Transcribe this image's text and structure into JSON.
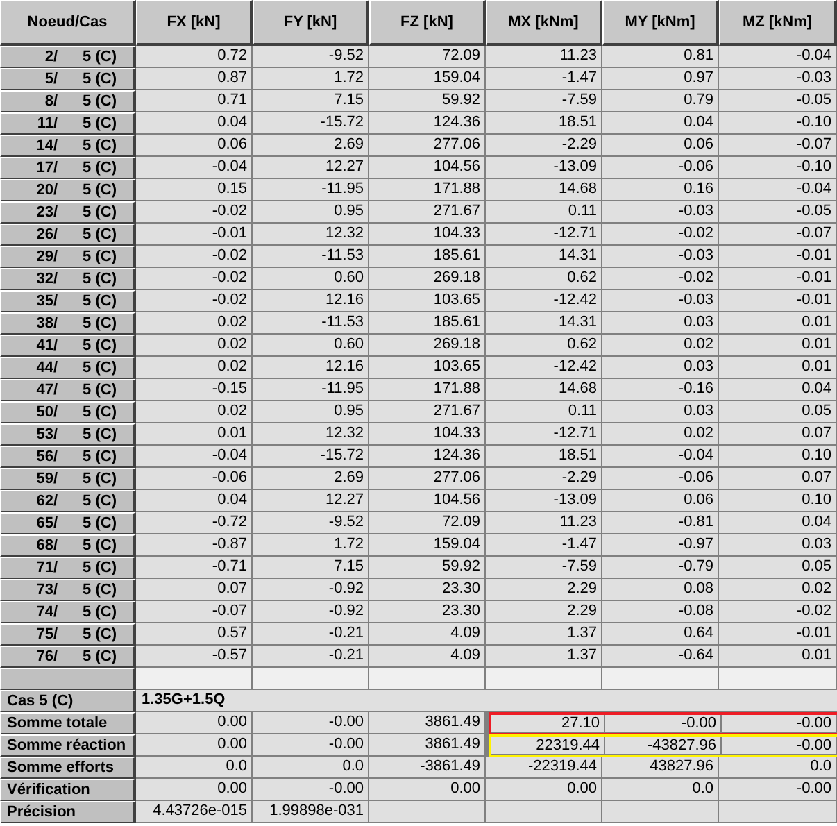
{
  "table": {
    "columns": [
      "Noeud/Cas",
      "FX [kN]",
      "FY [kN]",
      "FZ [kN]",
      "MX [kNm]",
      "MY [kNm]",
      "MZ [kNm]"
    ],
    "rows": [
      {
        "node": "2/",
        "case": "5 (C)",
        "values": [
          "0.72",
          "-9.52",
          "72.09",
          "11.23",
          "0.81",
          "-0.04"
        ]
      },
      {
        "node": "5/",
        "case": "5 (C)",
        "values": [
          "0.87",
          "1.72",
          "159.04",
          "-1.47",
          "0.97",
          "-0.03"
        ]
      },
      {
        "node": "8/",
        "case": "5 (C)",
        "values": [
          "0.71",
          "7.15",
          "59.92",
          "-7.59",
          "0.79",
          "-0.05"
        ]
      },
      {
        "node": "11/",
        "case": "5 (C)",
        "values": [
          "0.04",
          "-15.72",
          "124.36",
          "18.51",
          "0.04",
          "-0.10"
        ]
      },
      {
        "node": "14/",
        "case": "5 (C)",
        "values": [
          "0.06",
          "2.69",
          "277.06",
          "-2.29",
          "0.06",
          "-0.07"
        ]
      },
      {
        "node": "17/",
        "case": "5 (C)",
        "values": [
          "-0.04",
          "12.27",
          "104.56",
          "-13.09",
          "-0.06",
          "-0.10"
        ]
      },
      {
        "node": "20/",
        "case": "5 (C)",
        "values": [
          "0.15",
          "-11.95",
          "171.88",
          "14.68",
          "0.16",
          "-0.04"
        ]
      },
      {
        "node": "23/",
        "case": "5 (C)",
        "values": [
          "-0.02",
          "0.95",
          "271.67",
          "0.11",
          "-0.03",
          "-0.05"
        ]
      },
      {
        "node": "26/",
        "case": "5 (C)",
        "values": [
          "-0.01",
          "12.32",
          "104.33",
          "-12.71",
          "-0.02",
          "-0.07"
        ]
      },
      {
        "node": "29/",
        "case": "5 (C)",
        "values": [
          "-0.02",
          "-11.53",
          "185.61",
          "14.31",
          "-0.03",
          "-0.01"
        ]
      },
      {
        "node": "32/",
        "case": "5 (C)",
        "values": [
          "-0.02",
          "0.60",
          "269.18",
          "0.62",
          "-0.02",
          "-0.01"
        ]
      },
      {
        "node": "35/",
        "case": "5 (C)",
        "values": [
          "-0.02",
          "12.16",
          "103.65",
          "-12.42",
          "-0.03",
          "-0.01"
        ]
      },
      {
        "node": "38/",
        "case": "5 (C)",
        "values": [
          "0.02",
          "-11.53",
          "185.61",
          "14.31",
          "0.03",
          "0.01"
        ]
      },
      {
        "node": "41/",
        "case": "5 (C)",
        "values": [
          "0.02",
          "0.60",
          "269.18",
          "0.62",
          "0.02",
          "0.01"
        ]
      },
      {
        "node": "44/",
        "case": "5 (C)",
        "values": [
          "0.02",
          "12.16",
          "103.65",
          "-12.42",
          "0.03",
          "0.01"
        ]
      },
      {
        "node": "47/",
        "case": "5 (C)",
        "values": [
          "-0.15",
          "-11.95",
          "171.88",
          "14.68",
          "-0.16",
          "0.04"
        ]
      },
      {
        "node": "50/",
        "case": "5 (C)",
        "values": [
          "0.02",
          "0.95",
          "271.67",
          "0.11",
          "0.03",
          "0.05"
        ]
      },
      {
        "node": "53/",
        "case": "5 (C)",
        "values": [
          "0.01",
          "12.32",
          "104.33",
          "-12.71",
          "0.02",
          "0.07"
        ]
      },
      {
        "node": "56/",
        "case": "5 (C)",
        "values": [
          "-0.04",
          "-15.72",
          "124.36",
          "18.51",
          "-0.04",
          "0.10"
        ]
      },
      {
        "node": "59/",
        "case": "5 (C)",
        "values": [
          "-0.06",
          "2.69",
          "277.06",
          "-2.29",
          "-0.06",
          "0.07"
        ]
      },
      {
        "node": "62/",
        "case": "5 (C)",
        "values": [
          "0.04",
          "12.27",
          "104.56",
          "-13.09",
          "0.06",
          "0.10"
        ]
      },
      {
        "node": "65/",
        "case": "5 (C)",
        "values": [
          "-0.72",
          "-9.52",
          "72.09",
          "11.23",
          "-0.81",
          "0.04"
        ]
      },
      {
        "node": "68/",
        "case": "5 (C)",
        "values": [
          "-0.87",
          "1.72",
          "159.04",
          "-1.47",
          "-0.97",
          "0.03"
        ]
      },
      {
        "node": "71/",
        "case": "5 (C)",
        "values": [
          "-0.71",
          "7.15",
          "59.92",
          "-7.59",
          "-0.79",
          "0.05"
        ]
      },
      {
        "node": "73/",
        "case": "5 (C)",
        "values": [
          "0.07",
          "-0.92",
          "23.30",
          "2.29",
          "0.08",
          "0.02"
        ]
      },
      {
        "node": "74/",
        "case": "5 (C)",
        "values": [
          "-0.07",
          "-0.92",
          "23.30",
          "2.29",
          "-0.08",
          "-0.02"
        ]
      },
      {
        "node": "75/",
        "case": "5 (C)",
        "values": [
          "0.57",
          "-0.21",
          "4.09",
          "1.37",
          "0.64",
          "-0.01"
        ]
      },
      {
        "node": "76/",
        "case": "5 (C)",
        "values": [
          "-0.57",
          "-0.21",
          "4.09",
          "1.37",
          "-0.64",
          "0.01"
        ]
      }
    ]
  },
  "summary": {
    "case_label": "Cas 5 (C)",
    "combination": "1.35G+1.5Q",
    "rows": [
      {
        "label": "Somme totale",
        "values": [
          "0.00",
          "-0.00",
          "3861.49",
          "27.10",
          "-0.00",
          "-0.00"
        ],
        "color": "#ee1c25"
      },
      {
        "label": "Somme réaction",
        "values": [
          "0.00",
          "-0.00",
          "3861.49",
          "22319.44",
          "-43827.96",
          "-0.00"
        ],
        "color": "#fff200"
      },
      {
        "label": "Somme efforts",
        "values": [
          "0.0",
          "0.0",
          "-3861.49",
          "-22319.44",
          "43827.96",
          "0.0"
        ]
      },
      {
        "label": "Vérification",
        "values": [
          "0.00",
          "-0.00",
          "0.00",
          "0.00",
          "0.0",
          "-0.00"
        ]
      },
      {
        "label": "Précision",
        "values": [
          "4.43726e-015",
          "1.99898e-031"
        ]
      }
    ]
  }
}
